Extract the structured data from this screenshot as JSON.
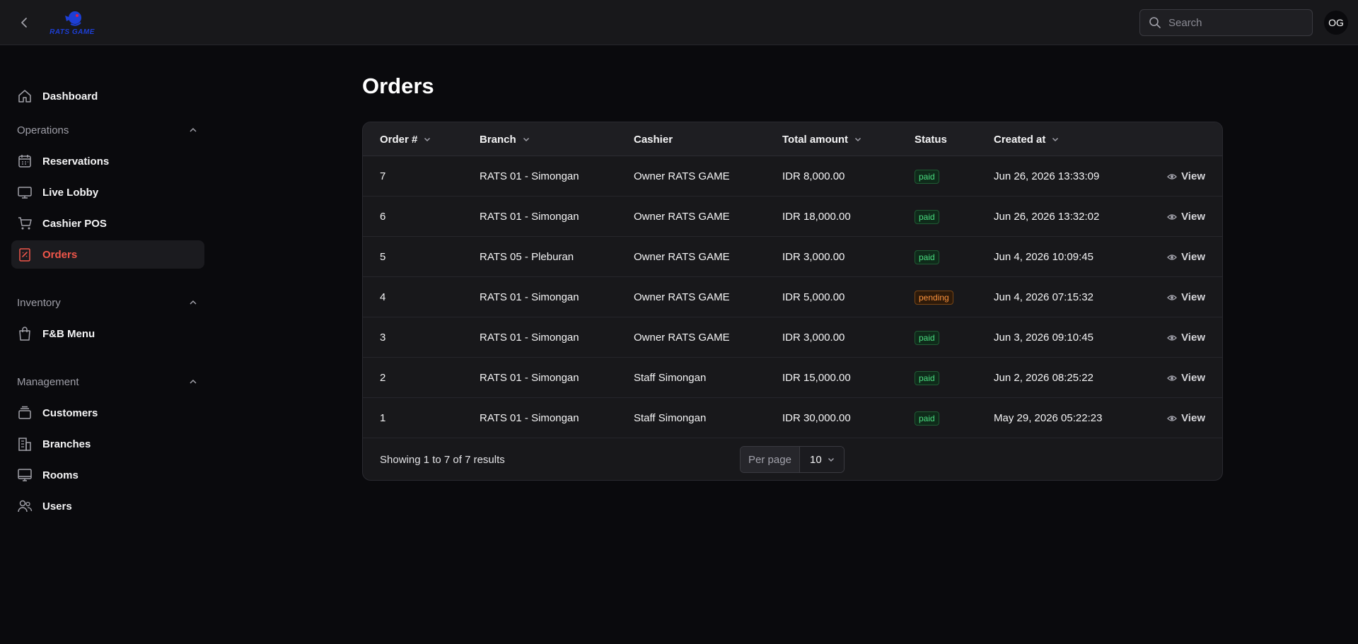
{
  "header": {
    "logo_text": "RATS GAME",
    "search_placeholder": "Search",
    "avatar_initials": "OG"
  },
  "sidebar": {
    "dashboard": "Dashboard",
    "groups": [
      {
        "label": "Operations",
        "items": [
          "Reservations",
          "Live Lobby",
          "Cashier POS",
          "Orders"
        ]
      },
      {
        "label": "Inventory",
        "items": [
          "F&B Menu"
        ]
      },
      {
        "label": "Management",
        "items": [
          "Customers",
          "Branches",
          "Rooms",
          "Users"
        ]
      }
    ],
    "active_item": "Orders",
    "active_color": "#f0564a"
  },
  "page": {
    "title": "Orders"
  },
  "table": {
    "columns": [
      "Order #",
      "Branch",
      "Cashier",
      "Total amount",
      "Status",
      "Created at"
    ],
    "view_label": "View",
    "rows": [
      {
        "order": "7",
        "branch": "RATS 01 - Simongan",
        "cashier": "Owner RATS GAME",
        "total": "IDR 8,000.00",
        "status": "paid",
        "created": "Jun 26, 2026 13:33:09"
      },
      {
        "order": "6",
        "branch": "RATS 01 - Simongan",
        "cashier": "Owner RATS GAME",
        "total": "IDR 18,000.00",
        "status": "paid",
        "created": "Jun 26, 2026 13:32:02"
      },
      {
        "order": "5",
        "branch": "RATS 05 - Pleburan",
        "cashier": "Owner RATS GAME",
        "total": "IDR 3,000.00",
        "status": "paid",
        "created": "Jun 4, 2026 10:09:45"
      },
      {
        "order": "4",
        "branch": "RATS 01 - Simongan",
        "cashier": "Owner RATS GAME",
        "total": "IDR 5,000.00",
        "status": "pending",
        "created": "Jun 4, 2026 07:15:32"
      },
      {
        "order": "3",
        "branch": "RATS 01 - Simongan",
        "cashier": "Owner RATS GAME",
        "total": "IDR 3,000.00",
        "status": "paid",
        "created": "Jun 3, 2026 09:10:45"
      },
      {
        "order": "2",
        "branch": "RATS 01 - Simongan",
        "cashier": "Staff Simongan",
        "total": "IDR 15,000.00",
        "status": "paid",
        "created": "Jun 2, 2026 08:25:22"
      },
      {
        "order": "1",
        "branch": "RATS 01 - Simongan",
        "cashier": "Staff Simongan",
        "total": "IDR 30,000.00",
        "status": "paid",
        "created": "May 29, 2026 05:22:23"
      }
    ],
    "footer": {
      "showing": "Showing 1 to 7 of 7 results",
      "per_page_label": "Per page",
      "per_page_value": "10"
    },
    "status_colors": {
      "paid": "#4ade80",
      "pending": "#fb923c"
    }
  }
}
